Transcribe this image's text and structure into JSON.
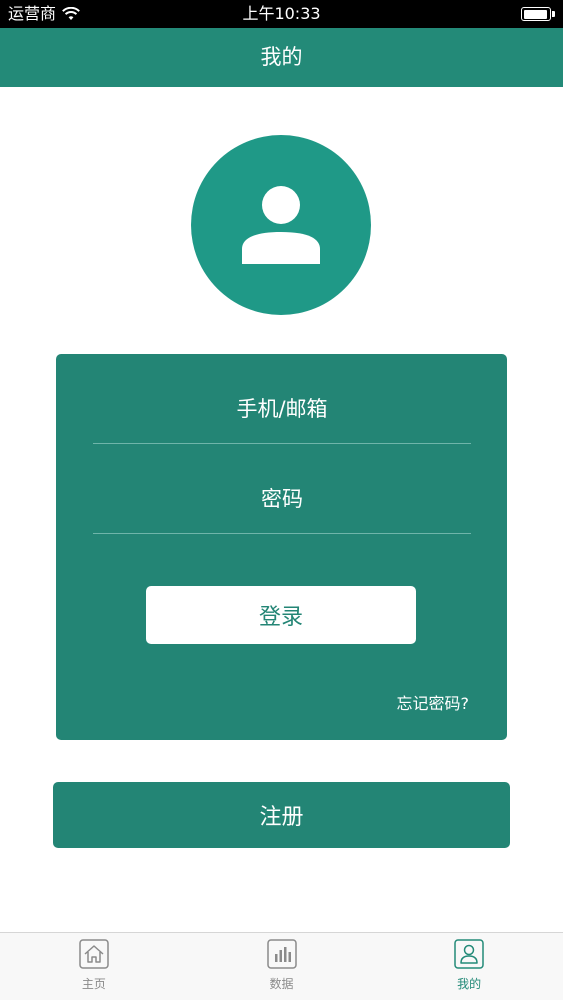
{
  "status_bar": {
    "carrier": "运营商",
    "time": "上午10:33",
    "battery_level": 0.95
  },
  "nav": {
    "title": "我的"
  },
  "login": {
    "account_placeholder": "手机/邮箱",
    "account_value": "",
    "password_placeholder": "密码",
    "password_value": "",
    "login_label": "登录",
    "forgot_label": "忘记密码?"
  },
  "register": {
    "label": "注册"
  },
  "tabs": [
    {
      "label": "主页",
      "icon": "home-icon",
      "active": false
    },
    {
      "label": "数据",
      "icon": "chart-icon",
      "active": false
    },
    {
      "label": "我的",
      "icon": "user-icon",
      "active": true
    }
  ],
  "colors": {
    "primary": "#238a78",
    "card": "#238575",
    "avatar": "#1f9987",
    "tab_inactive": "#8a8a8a"
  }
}
